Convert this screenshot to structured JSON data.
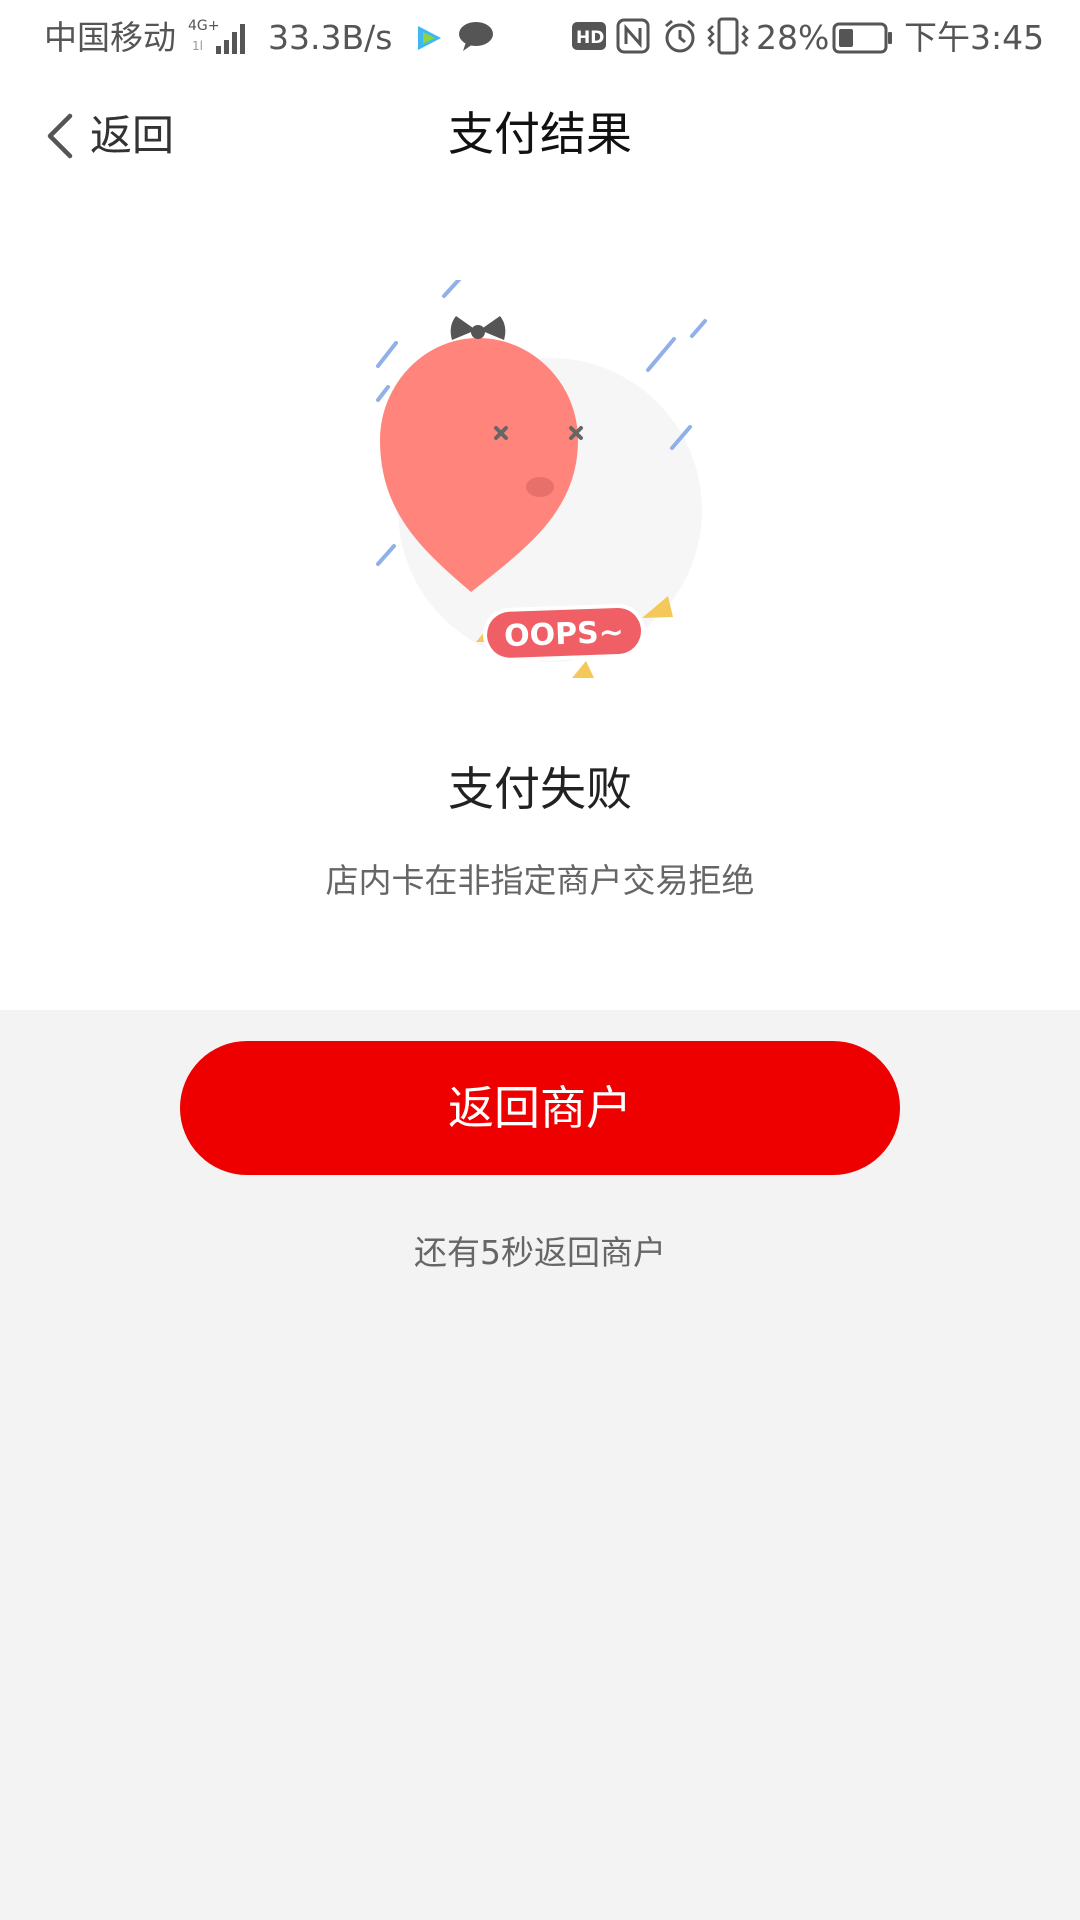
{
  "status_bar": {
    "carrier": "中国移动",
    "network": "4G⁺",
    "speed": "33.3B/s",
    "battery": "28%",
    "time": "下午3:45",
    "icons": [
      "signal-icon",
      "video-app-icon",
      "chat-bubble-icon",
      "hd-icon",
      "nfc-icon",
      "alarm-icon",
      "vibrate-icon",
      "battery-icon"
    ]
  },
  "nav": {
    "back_label": "返回",
    "title": "支付结果"
  },
  "illustration": {
    "badge_text": "OOPS~",
    "colors": {
      "drop": "#ff857c",
      "lines": "#8fb0e8",
      "triangles": "#f5c85a",
      "bow": "#555555"
    }
  },
  "result": {
    "title": "支付失败",
    "message": "店内卡在非指定商户交易拒绝"
  },
  "actions": {
    "return_label": "返回商户",
    "countdown": "还有5秒返回商户"
  },
  "colors": {
    "accent": "#ee0000",
    "background": "#f3f3f3"
  }
}
